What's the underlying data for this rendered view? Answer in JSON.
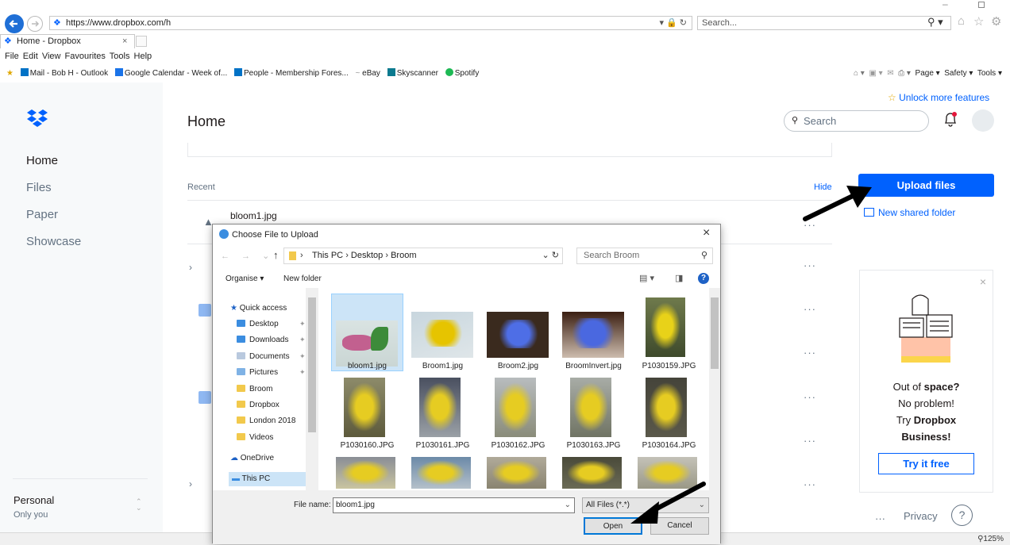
{
  "browser": {
    "url": "https://www.dropbox.com/h",
    "search_placeholder": "Search...",
    "tab_title": "Home - Dropbox",
    "menu": [
      "File",
      "Edit",
      "View",
      "Favourites",
      "Tools",
      "Help"
    ],
    "favourites": [
      "Mail - Bob H - Outlook",
      "Google Calendar - Week of...",
      "People - Membership Fores...",
      "eBay",
      "Skyscanner",
      "Spotify"
    ],
    "commands": [
      "Page",
      "Safety",
      "Tools"
    ],
    "zoom": "125%"
  },
  "sidebar": {
    "items": [
      "Home",
      "Files",
      "Paper",
      "Showcase"
    ],
    "account_title": "Personal",
    "account_sub": "Only you"
  },
  "main": {
    "title": "Home",
    "unlock_link": "Unlock more features",
    "search_placeholder": "Search",
    "recent_label": "Recent",
    "hide_link": "Hide",
    "first_recent_file": "bloom1.jpg",
    "upload_button": "Upload files",
    "new_shared_folder": "New shared folder",
    "privacy": "Privacy",
    "help": "?"
  },
  "promo": {
    "line1_a": "Out of ",
    "line1_b": "space?",
    "line2": "No problem!",
    "line3_a": "Try ",
    "line3_b": "Dropbox",
    "line4": "Business!",
    "cta": "Try it free"
  },
  "dialog": {
    "title": "Choose File to Upload",
    "breadcrumb": [
      "This PC",
      "Desktop",
      "Broom"
    ],
    "search_placeholder": "Search Broom",
    "organise": "Organise",
    "new_folder": "New folder",
    "tree": {
      "quick_access": "Quick access",
      "items": [
        "Desktop",
        "Downloads",
        "Documents",
        "Pictures",
        "Broom",
        "Dropbox",
        "London 2018",
        "Videos"
      ],
      "onedrive": "OneDrive",
      "this_pc": "This PC"
    },
    "files": [
      "bloom1.jpg",
      "Broom1.jpg",
      "Broom2.jpg",
      "BroomInvert.jpg",
      "P1030159.JPG",
      "P1030160.JPG",
      "P1030161.JPG",
      "P1030162.JPG",
      "P1030163.JPG",
      "P1030164.JPG"
    ],
    "file_name_label": "File name:",
    "file_name_value": "bloom1.jpg",
    "file_type": "All Files (*.*)",
    "open_button": "Open",
    "cancel_button": "Cancel"
  }
}
